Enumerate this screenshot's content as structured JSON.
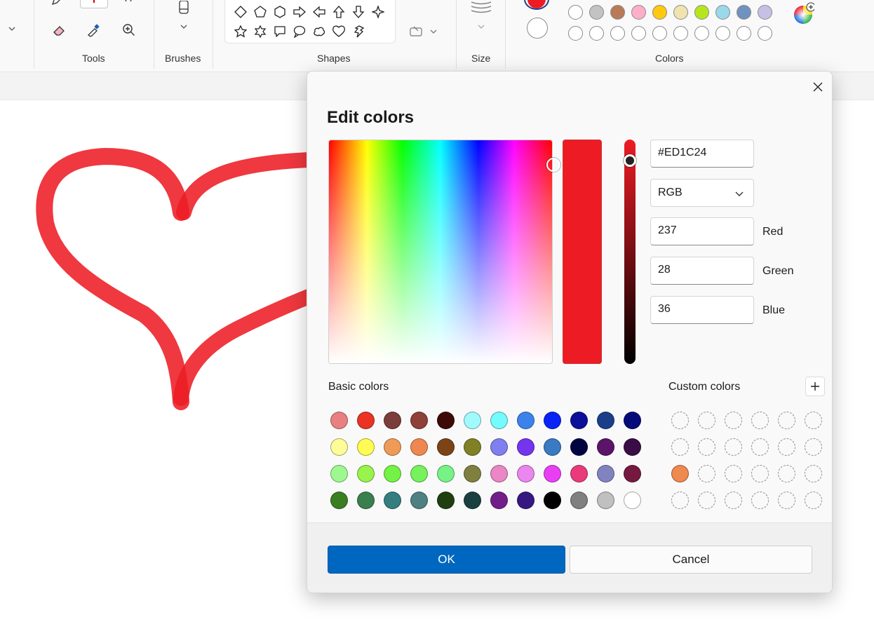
{
  "ribbon": {
    "groups": {
      "tools": "Tools",
      "brushes": "Brushes",
      "shapes": "Shapes",
      "size": "Size",
      "colors": "Colors"
    },
    "icons": [
      "pencil-icon",
      "fill-icon",
      "text-icon",
      "eraser-icon",
      "color-picker-icon",
      "magnifier-icon",
      "brush-icon",
      "outline-icon",
      "fill-style-icon",
      "size-lines-icon",
      "edit-colors-icon"
    ],
    "shape_icons": [
      "diamond",
      "pentagon",
      "hexagon",
      "arrow-right",
      "arrow-left",
      "arrow-up",
      "arrow-down",
      "four-point-star",
      "five-point-star",
      "six-point-star",
      "rect-callout",
      "oval-callout",
      "cloud-callout",
      "heart",
      "lightning"
    ],
    "primary_color": "#ED1C24",
    "secondary_color": "#FFFFFF",
    "palette_row1": [
      "#FFFFFF",
      "#C3C3C3",
      "#B97A57",
      "#FFAEC9",
      "#FFC90E",
      "#EFE4B0",
      "#B5E61D",
      "#99D9EA",
      "#7092BE",
      "#C8BFE7"
    ],
    "palette_row2_empty_count": 10
  },
  "canvas": {
    "stroke_color": "#ED1C24"
  },
  "dialog": {
    "title": "Edit colors",
    "hex_value": "#ED1C24",
    "mode": "RGB",
    "channels": [
      {
        "label": "Red",
        "value": "237"
      },
      {
        "label": "Green",
        "value": "28"
      },
      {
        "label": "Blue",
        "value": "36"
      }
    ],
    "basic_colors_label": "Basic colors",
    "custom_colors_label": "Custom colors",
    "basic_colors": [
      [
        "#E88082",
        "#EA3323",
        "#7B3D3A",
        "#8F4037",
        "#3D0A07",
        "#A1FBFD",
        "#75FBFD",
        "#3B83EB",
        "#0823F5",
        "#0C0F9A",
        "#1A3E8A",
        "#050A7B"
      ],
      [
        "#FEFC98",
        "#FEFC54",
        "#EE9B57",
        "#EE8850",
        "#7C4316",
        "#808026",
        "#7F7FF0",
        "#7434F0",
        "#3A7AC2",
        "#020442",
        "#5B1468",
        "#3A0D46"
      ],
      [
        "#9DF98F",
        "#98F34D",
        "#75F246",
        "#75F25D",
        "#76F286",
        "#7F8040",
        "#EA87C4",
        "#EB86EE",
        "#E93FF2",
        "#E93A7C",
        "#8183C1",
        "#761940"
      ],
      [
        "#3A7E22",
        "#3A7F4E",
        "#347E80",
        "#4F8082",
        "#1F3F10",
        "#19403F",
        "#721E8A",
        "#361881",
        "#000000",
        "#808080",
        "#C0C0C0",
        "#FFFFFF"
      ]
    ],
    "custom_colors": [
      [
        null,
        null,
        null,
        null,
        null,
        null
      ],
      [
        null,
        null,
        null,
        null,
        null,
        null
      ],
      [
        "#EE8950",
        null,
        null,
        null,
        null,
        null
      ],
      [
        null,
        null,
        null,
        null,
        null,
        null
      ]
    ],
    "ok_label": "OK",
    "cancel_label": "Cancel",
    "accent": "#0067C0"
  }
}
